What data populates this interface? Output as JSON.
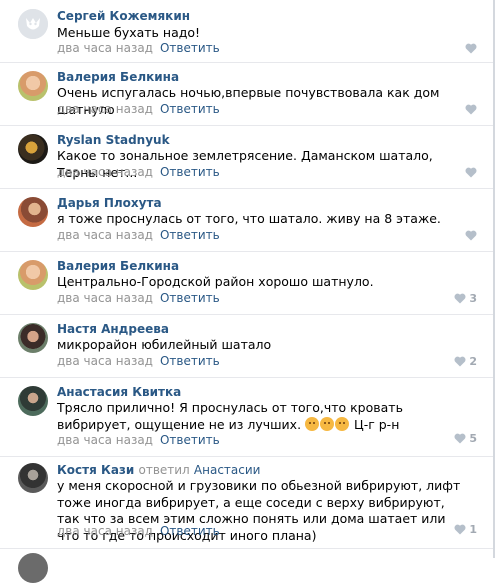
{
  "comments": [
    {
      "author": "Сергей Кожемякин",
      "text": "Меньше бухать надо!",
      "time": "два часа назад",
      "reply_label": "Ответить",
      "likes": "",
      "avatar": "vk-default-icon"
    },
    {
      "author": "Валерия Белкина",
      "text": "Очень испугалась ночью,впервые почувствовала как дом шатнуло",
      "time": "два часа назад",
      "reply_label": "Ответить",
      "likes": "",
      "avatar": "user-photo"
    },
    {
      "author": "Ryslan Stadnyuk",
      "text": "Какое то зональное землетрясение. Даманском шатало, Терны нет...",
      "time": "два часа назад",
      "reply_label": "Ответить",
      "likes": "",
      "avatar": "user-photo"
    },
    {
      "author": "Дарья Плохута",
      "text": "я тоже проснулась от того, что шатало. живу на 8 этаже.",
      "time": "два часа назад",
      "reply_label": "Ответить",
      "likes": "",
      "avatar": "user-photo"
    },
    {
      "author": "Валерия Белкина",
      "text": "Центрально-Городской район хорошо шатнуло.",
      "time": "два часа назад",
      "reply_label": "Ответить",
      "likes": "3",
      "avatar": "user-photo"
    },
    {
      "author": "Настя Андреева",
      "text": "микрорайон юбилейный шатало",
      "time": "два часа назад",
      "reply_label": "Ответить",
      "likes": "2",
      "avatar": "user-photo"
    },
    {
      "author": "Анастасия Квитка",
      "text_before": "Трясло прилично! Я проснулась от того,что кровать вибрирует, ощущение не из лучших. ",
      "text_after": " Ц-г р-н",
      "time": "два часа назад",
      "reply_label": "Ответить",
      "likes": "5",
      "avatar": "user-photo"
    },
    {
      "author": "Костя Кази",
      "reply_to_word": "ответил",
      "reply_to_name": "Анастасии",
      "text": "у меня скоросной и грузовики по обьезной вибрируют, лифт тоже иногда вибрирует, а еще соседи с верху вибрируют, так что за всем этим сложно понять или дома шатает или что то где то происходит иного плана)",
      "time": "два часа назад",
      "reply_label": "Ответить",
      "likes": "1",
      "avatar": "user-photo"
    }
  ],
  "colors": {
    "link": "#2a5885",
    "meta": "#939393",
    "heart": "#b5bfca",
    "divider": "#e7e8ec"
  }
}
